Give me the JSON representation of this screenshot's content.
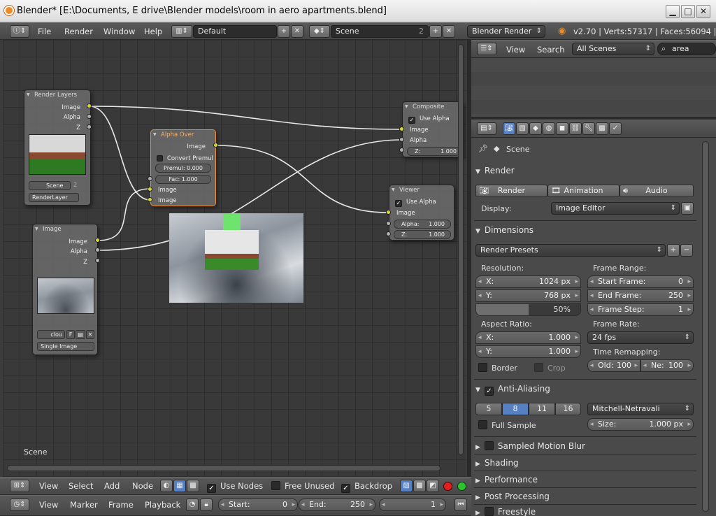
{
  "window": {
    "title": "Blender* [E:\\Documents, E drive\\Blender models\\room in aero apartments.blend]"
  },
  "info_header": {
    "menus": [
      "File",
      "Render",
      "Window",
      "Help"
    ],
    "layout": "Default",
    "scene": "Scene",
    "scene_users": "2",
    "engine": "Blender Render",
    "stats": "v2.70 | Verts:57317 | Faces:56094 | Tr"
  },
  "outliner_header": {
    "view": "View",
    "search": "Search",
    "filter": "All Scenes",
    "search_value": "area"
  },
  "nodes": {
    "render_layers": {
      "title": "Render Layers",
      "outputs": [
        "Image",
        "Alpha",
        "Z"
      ],
      "scene": "Scene",
      "users": "2",
      "layer": "RenderLayer"
    },
    "alpha_over": {
      "title": "Alpha Over",
      "output": "Image",
      "convert": "Convert Premul",
      "premul_label": "Premul:",
      "premul_value": "0.000",
      "fac_label": "Fac:",
      "fac_value": "1.000",
      "inputs": [
        "Image",
        "Image"
      ]
    },
    "image": {
      "title": "Image",
      "outputs": [
        "Image",
        "Alpha",
        "Z"
      ],
      "image_name": "clou",
      "f_label": "F",
      "source": "Single Image"
    },
    "composite": {
      "title": "Composite",
      "use_alpha": "Use Alpha",
      "inputs": [
        "Image",
        "Alpha"
      ],
      "z_label": "Z:",
      "z_value": "1.000"
    },
    "viewer": {
      "title": "Viewer",
      "use_alpha": "Use Alpha",
      "input": "Image",
      "alpha_label": "Alpha:",
      "alpha_value": "1.000",
      "z_label": "Z:",
      "z_value": "1.000"
    },
    "scene_label": "Scene"
  },
  "node_header": {
    "menus": [
      "View",
      "Select",
      "Add",
      "Node"
    ],
    "use_nodes": "Use Nodes",
    "free_unused": "Free Unused",
    "backdrop": "Backdrop"
  },
  "timeline_header": {
    "menus": [
      "View",
      "Marker",
      "Frame",
      "Playback"
    ],
    "start_label": "Start:",
    "start": "0",
    "end_label": "End:",
    "end": "250",
    "current": "1"
  },
  "properties": {
    "context": "Scene",
    "render": {
      "title": "Render",
      "render_btn": "Render",
      "animation_btn": "Animation",
      "audio_btn": "Audio",
      "display_label": "Display:",
      "display_value": "Image Editor"
    },
    "dimensions": {
      "title": "Dimensions",
      "presets": "Render Presets",
      "resolution_label": "Resolution:",
      "res_x_label": "X:",
      "res_x": "1024 px",
      "res_y_label": "Y:",
      "res_y": "768 px",
      "res_pct": "50%",
      "res_pct_value": 0.5,
      "frame_range_label": "Frame Range:",
      "start_label": "Start Frame:",
      "start": "0",
      "end_label": "End Frame:",
      "end": "250",
      "step_label": "Frame Step:",
      "step": "1",
      "aspect_label": "Aspect Ratio:",
      "asp_x_label": "X:",
      "asp_x": "1.000",
      "asp_y_label": "Y:",
      "asp_y": "1.000",
      "frame_rate_label": "Frame Rate:",
      "frame_rate": "24 fps",
      "remap_label": "Time Remapping:",
      "old_label": "Old:",
      "old": "100",
      "new_label": "Ne:",
      "new": "100",
      "border": "Border",
      "crop": "Crop"
    },
    "aa": {
      "title": "Anti-Aliasing",
      "samples": [
        "5",
        "8",
        "11",
        "16"
      ],
      "active": "8",
      "filter": "Mitchell-Netravali",
      "full_sample": "Full Sample",
      "size_label": "Size:",
      "size": "1.000 px"
    },
    "collapsed": [
      "Sampled Motion Blur",
      "Shading",
      "Performance",
      "Post Processing",
      "Freestyle"
    ]
  },
  "colors": {
    "accent": "#5680c2",
    "socket": "#d8d83a",
    "selected": "#e89030"
  }
}
